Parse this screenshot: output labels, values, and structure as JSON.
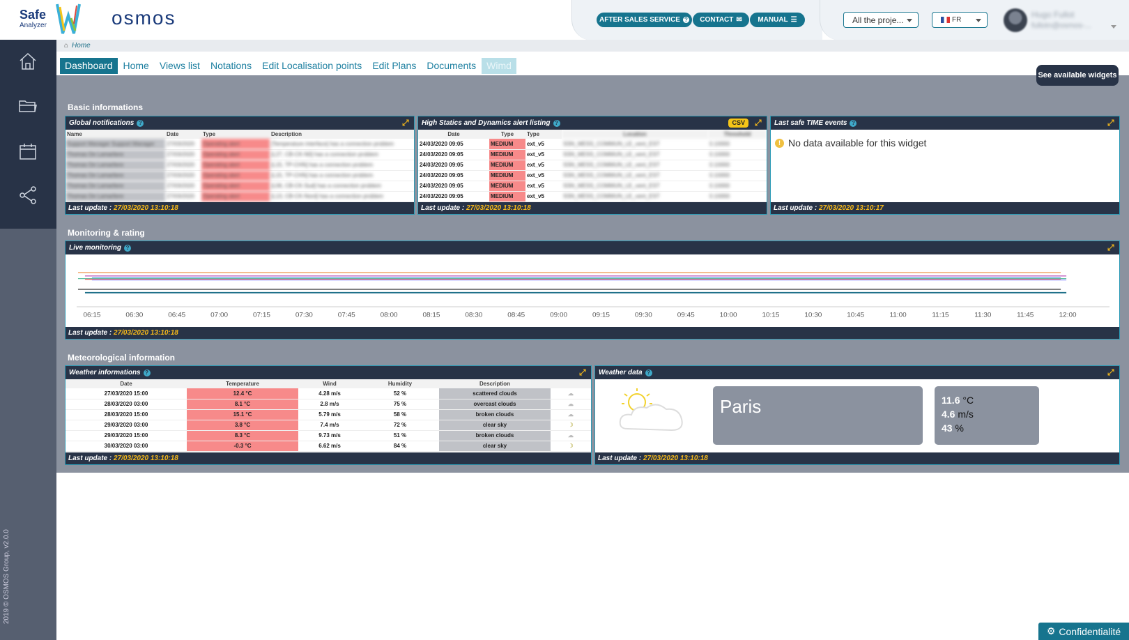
{
  "header": {
    "logo_safe": "Safe",
    "logo_analyzer": "Analyzer",
    "brand": "osmos",
    "after_sales": "AFTER SALES SERVICE",
    "contact": "CONTACT",
    "manual": "MANUAL",
    "project_select": "All the proje...",
    "language": "FR",
    "user_name": "Hugo Fullot",
    "user_email": "fullotn@osmos-..."
  },
  "breadcrumb": {
    "home": "Home"
  },
  "tabs": [
    "Dashboard",
    "Home",
    "Views list",
    "Notations",
    "Edit Localisation points",
    "Edit Plans",
    "Documents",
    "Wimd"
  ],
  "see_widgets": "See available widgets",
  "sections": {
    "basic": "Basic informations",
    "monitoring": "Monitoring & rating",
    "meteo": "Meteorological information"
  },
  "global_notifications": {
    "title": "Global notifications",
    "columns": [
      "Name",
      "Date",
      "Type",
      "Description"
    ],
    "rows": [
      [
        "Support Manager Support Manager",
        "27/03/2020",
        "Operating alert",
        "[Temperature interface] has a connection problem"
      ],
      [
        "Thomas De Lamarliere",
        "27/03/2020",
        "Operating alert",
        "[L27, CB-CK-N0] has a connection problem"
      ],
      [
        "Thomas De Lamarliere",
        "27/03/2020",
        "Operating alert",
        "[L15, TP-CHN] has a connection problem"
      ],
      [
        "Thomas De Lamarliere",
        "27/03/2020",
        "Operating alert",
        "[L15, TP-CHN] has a connection problem"
      ],
      [
        "Thomas De Lamarliere",
        "27/03/2020",
        "Operating alert",
        "[L06, CB-CK-Sud] has a connection problem"
      ],
      [
        "Thomas De Lamarliere",
        "27/03/2020",
        "Operating alert",
        "[L13, CB-CK-Nord] has a connection problem"
      ]
    ],
    "last_update_label": "Last update :",
    "last_update": "27/03/2020 13:10:18"
  },
  "alerts": {
    "title": "High Statics and Dynamics alert listing",
    "csv": "CSV",
    "columns": [
      "Date",
      "Type",
      "Type",
      "Location",
      "Threshold"
    ],
    "rows": [
      [
        "24/03/2020 09:05",
        "MEDIUM",
        "ext_v5",
        "SSN_MESS_COMMUN_LE_vent_EST",
        "0.10000"
      ],
      [
        "24/03/2020 09:05",
        "MEDIUM",
        "ext_v5",
        "SSN_MESS_COMMUN_LE_vent_EST",
        "0.10000"
      ],
      [
        "24/03/2020 09:05",
        "MEDIUM",
        "ext_v5",
        "SSN_MESS_COMMUN_LE_vent_EST",
        "0.10000"
      ],
      [
        "24/03/2020 09:05",
        "MEDIUM",
        "ext_v5",
        "SSN_MESS_COMMUN_LE_vent_EST",
        "0.10000"
      ],
      [
        "24/03/2020 09:05",
        "MEDIUM",
        "ext_v5",
        "SSN_MESS_COMMUN_LE_vent_EST",
        "0.10000"
      ],
      [
        "24/03/2020 09:05",
        "MEDIUM",
        "ext_v5",
        "SSN_MESS_COMMUN_LE_vent_EST",
        "0.10000"
      ]
    ],
    "last_update_label": "Last update :",
    "last_update": "27/03/2020 13:10:18"
  },
  "safe_time": {
    "title": "Last safe TIME events",
    "no_data": "No data available for this widget",
    "last_update_label": "Last update :",
    "last_update": "27/03/2020 13:10:17"
  },
  "live_monitoring": {
    "title": "Live monitoring",
    "last_update_label": "Last update :",
    "last_update": "27/03/2020 13:10:18"
  },
  "chart_data": {
    "type": "line",
    "x": [
      "06:15",
      "06:30",
      "06:45",
      "07:00",
      "07:15",
      "07:30",
      "07:45",
      "08:00",
      "08:15",
      "08:30",
      "08:45",
      "09:00",
      "09:15",
      "09:30",
      "09:45",
      "10:00",
      "10:15",
      "10:30",
      "10:45",
      "11:00",
      "11:15",
      "11:30",
      "11:45",
      "12:00"
    ],
    "series": [
      {
        "color": "#f0a060"
      },
      {
        "color": "#c060c0"
      },
      {
        "color": "#40a0e0"
      },
      {
        "color": "#60c0a0"
      },
      {
        "color": "#e06060"
      },
      {
        "color": "#a0a0ff"
      },
      {
        "color": "#333333"
      },
      {
        "color": "#1d6f88"
      }
    ],
    "grid": false
  },
  "weather_info": {
    "title": "Weather informations",
    "columns": [
      "Date",
      "Temperature",
      "Wind",
      "Humidity",
      "Description"
    ],
    "rows": [
      [
        "27/03/2020 15:00",
        "12.4 °C",
        "4.28 m/s",
        "52 %",
        "scattered clouds"
      ],
      [
        "28/03/2020 03:00",
        "8.1 °C",
        "2.8 m/s",
        "75 %",
        "overcast clouds"
      ],
      [
        "28/03/2020 15:00",
        "15.1 °C",
        "5.79 m/s",
        "58 %",
        "broken clouds"
      ],
      [
        "29/03/2020 03:00",
        "3.8 °C",
        "7.4 m/s",
        "72 %",
        "clear sky"
      ],
      [
        "29/03/2020 15:00",
        "8.3 °C",
        "9.73 m/s",
        "51 %",
        "broken clouds"
      ],
      [
        "30/03/2020 03:00",
        "-0.3 °C",
        "6.62 m/s",
        "84 %",
        "clear sky"
      ]
    ],
    "last_update_label": "Last update :",
    "last_update": "27/03/2020 13:10:18"
  },
  "weather_data": {
    "title": "Weather data",
    "city": "Paris",
    "temp": "11.6",
    "temp_unit": "°C",
    "wind": "4.6",
    "wind_unit": "m/s",
    "humidity": "43",
    "humidity_unit": "%",
    "last_update_label": "Last update :",
    "last_update": "27/03/2020 13:10:18"
  },
  "copyright": "2019 © OSMOS Group, v2.0.0",
  "confidentiality": "Confidentialité"
}
